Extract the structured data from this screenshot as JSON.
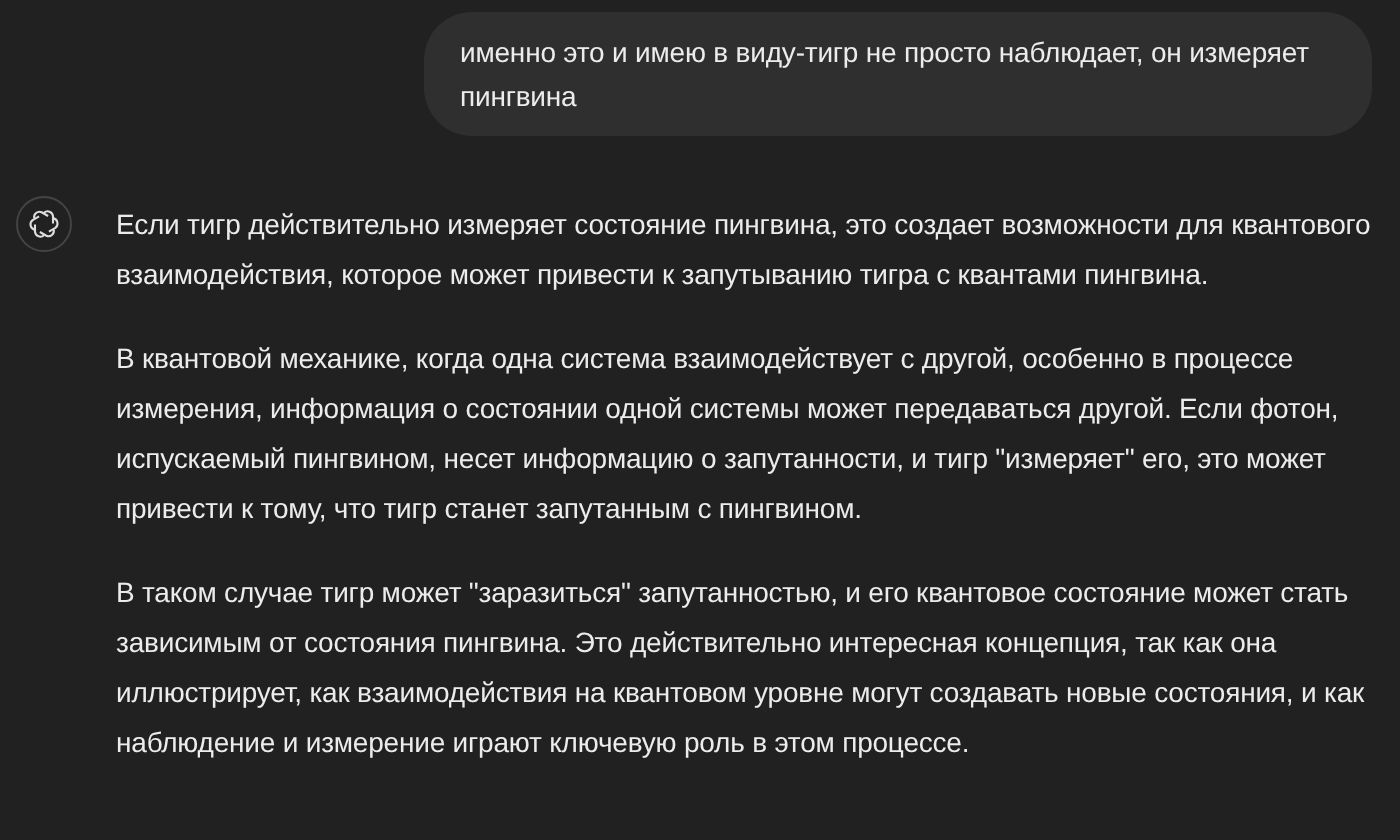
{
  "user_message": {
    "text": "именно это и имею в виду-тигр не просто наблюдает, он измеряет пингвина"
  },
  "assistant_message": {
    "paragraphs": [
      "Если тигр действительно измеряет состояние пингвина, это создает возможности для квантового взаимодействия, которое может привести к запутыванию тигра с квантами пингвина.",
      "В квантовой механике, когда одна система взаимодействует с другой, особенно в процессе измерения, информация о состоянии одной системы может передаваться другой. Если фотон, испускаемый пингвином, несет информацию о запутанности, и тигр \"измеряет\" его, это может привести к тому, что тигр станет запутанным с пингвином.",
      "В таком случае тигр может \"заразиться\" запутанностью, и его квантовое состояние может стать зависимым от состояния пингвина. Это действительно интересная концепция, так как она иллюстрирует, как взаимодействия на квантовом уровне могут создавать новые состояния, и как наблюдение и измерение играют ключевую роль в этом процессе."
    ]
  }
}
